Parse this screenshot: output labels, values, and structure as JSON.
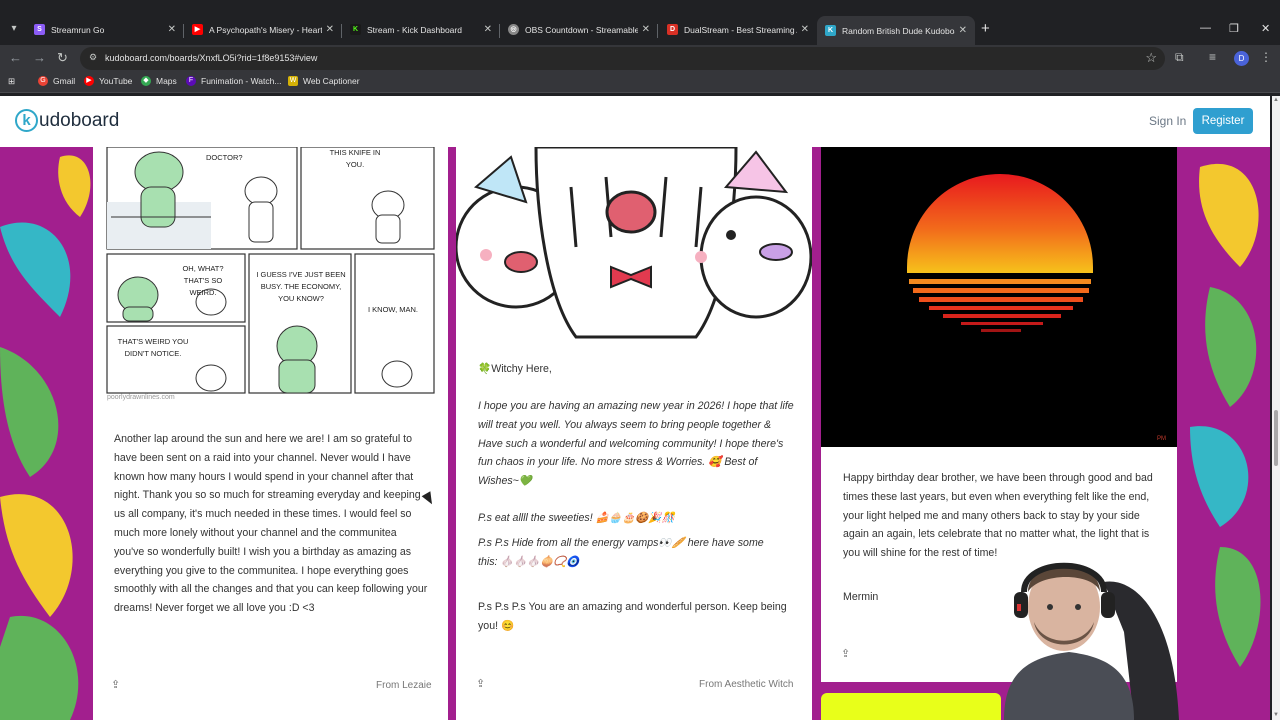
{
  "browser": {
    "tabs": [
      {
        "title": "Streamrun Go",
        "favicon_color": "#8b5cf6",
        "favicon_char": "S"
      },
      {
        "title": "A Psychopath's Misery - Heartless",
        "favicon_color": "#ff0000",
        "favicon_char": "▶"
      },
      {
        "title": "Stream - Kick Dashboard",
        "favicon_color": "#53fc18",
        "favicon_char": "K"
      },
      {
        "title": "OBS Countdown - Streamable C",
        "favicon_color": "#888888",
        "favicon_char": "◎"
      },
      {
        "title": "DualStream - Best Streaming Ap",
        "favicon_color": "#d93025",
        "favicon_char": "D"
      },
      {
        "title": "Random British Dude Kudoboard",
        "favicon_color": "#2fa7c9",
        "favicon_char": "K"
      }
    ],
    "url": "kudoboard.com/boards/XnxfLO5i?rid=1f8e9153#view",
    "profile_initial": "D",
    "bookmarks": [
      {
        "label": "Gmail",
        "icon_color": "#ea4335",
        "icon_char": "G"
      },
      {
        "label": "YouTube",
        "icon_color": "#ff0000",
        "icon_char": "▶"
      },
      {
        "label": "Maps",
        "icon_color": "#34a853",
        "icon_char": "◆"
      },
      {
        "label": "Funimation - Watch...",
        "icon_color": "#5b0bb5",
        "icon_char": "F"
      },
      {
        "label": "Web Captioner",
        "icon_color": "#d4b106",
        "icon_char": "W"
      }
    ]
  },
  "site": {
    "logo_letter": "k",
    "logo_text": "udoboard",
    "signin_label": "Sign In",
    "register_label": "Register"
  },
  "cards": [
    {
      "comic_panels": [
        "DOCTOR?",
        "THIS KNIFE IN YOU.",
        "OH, WHAT? THAT'S SO WEIRD.",
        "I GUESS I'VE JUST BEEN BUSY. THE ECONOMY, YOU KNOW?",
        "I KNOW, MAN.",
        "THAT'S WEIRD YOU DIDN'T NOTICE."
      ],
      "comic_credit": "poorlydrawnlines.com",
      "message": "Another lap around the sun and here we are! I am so grateful to have been sent on a raid into your channel. Never would I have known how many hours I would spend in your channel after that night. Thank you so so much for streaming everyday and keeping us all company, it's much needed in these times. I would feel so much more lonely without your channel and the communitea you've so wonderfully built! I wish you a birthday as amazing as everything you give to the communitea. I hope everything goes smoothly with all the changes and that you can keep following your dreams! Never forget we all love you :D <3",
      "from": "From Lezaie"
    },
    {
      "greeting": "🍀Witchy Here,",
      "para1": "I hope you are having an amazing new year in 2026! I hope that life will treat you well. You always seem to bring people together & Have such a wonderful and welcoming community! I hope there's fun chaos in your life. No more stress & Worries. 🥰 Best of Wishes~💚",
      "para2": "P.s eat allll the sweeties! 🍰🧁🎂🍪🎉🎊",
      "para3": "P.s P.s Hide from all the energy vamps👀🥖 here have some this: 🧄🧄🧄🧅📿🧿",
      "para4": "P.s P.s P.s You are an amazing and wonderful person. Keep being you! 😊",
      "from": "From Aesthetic Witch"
    },
    {
      "message": "Happy birthday dear brother, we have been through good and bad times these last years, but even when everything felt like the end, your light helped me and many others back to stay by your side again an again, lets celebrate that no matter what, the light that is you will shine for the rest of time!",
      "signature": "Mermin",
      "image_tag": "PM"
    }
  ],
  "colors": {
    "page_bg": "#a21f8e",
    "accent": "#2f9fd0",
    "leaf_green": "#5fb35a",
    "leaf_yellow": "#f3c82e",
    "leaf_teal": "#35b7c6"
  }
}
